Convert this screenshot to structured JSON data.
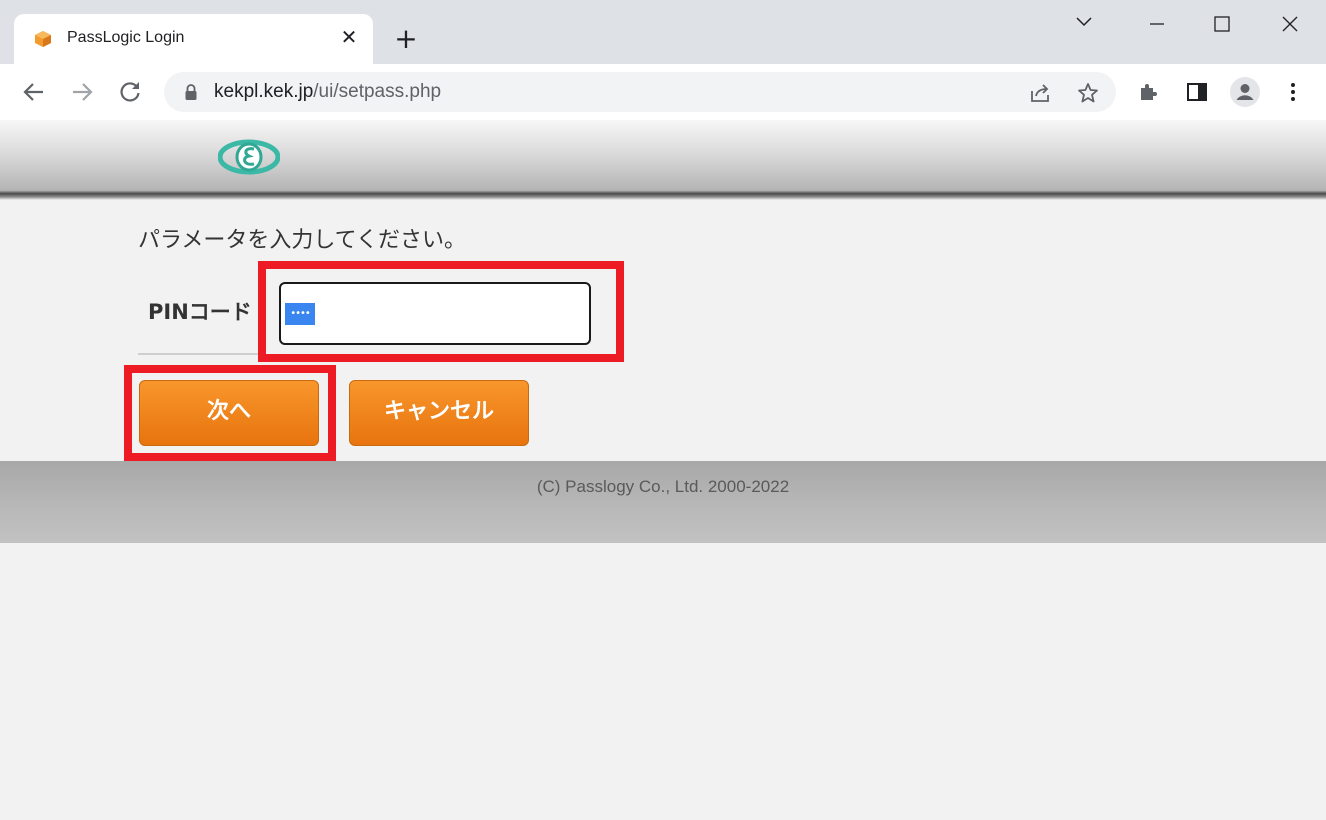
{
  "browser": {
    "tab_title": "PassLogic Login",
    "url_host": "kekpl.kek.jp",
    "url_path": "/ui/setpass.php",
    "tab_close_glyph": "✕",
    "new_tab_glyph": "+"
  },
  "page": {
    "instructions": "パラメータを入力してください。",
    "pin_label": "PINコード",
    "pin_mask": "••••",
    "next_button": "次へ",
    "cancel_button": "キャンセル",
    "copyright": "(C) Passlogy Co., Ltd. 2000-2022"
  },
  "colors": {
    "accent_orange": "#f08a1e",
    "highlight_red": "#ed1c24",
    "selection_blue": "#3a86f0"
  }
}
